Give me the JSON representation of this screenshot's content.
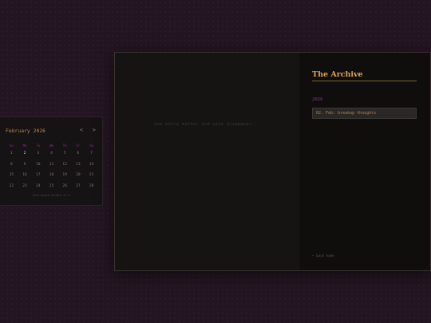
{
  "calendar": {
    "month_label": "February 2026",
    "prev_icon": "chevron-left-icon",
    "next_icon": "chevron-right-icon",
    "prev_glyph": "<",
    "next_glyph": ">",
    "weekdays": [
      "Su",
      "Mo",
      "Tu",
      "We",
      "Th",
      "Fr",
      "Sa"
    ],
    "days": [
      "1",
      "2",
      "3",
      "4",
      "5",
      "6",
      "7",
      "8",
      "9",
      "10",
      "11",
      "12",
      "13",
      "14",
      "15",
      "16",
      "17",
      "18",
      "19",
      "20",
      "21",
      "22",
      "23",
      "24",
      "25",
      "26",
      "27",
      "28"
    ],
    "today": "2",
    "footer": "love-notes-studio v1.2",
    "accent": "#8e1490"
  },
  "main": {
    "quote": "one entry matter and wine disappear..."
  },
  "archive": {
    "title": "The Archive",
    "year": "2026",
    "entries": [
      "02. Feb: breakup thoughts"
    ],
    "back_link": "← back home",
    "title_color": "#e0a54e"
  }
}
